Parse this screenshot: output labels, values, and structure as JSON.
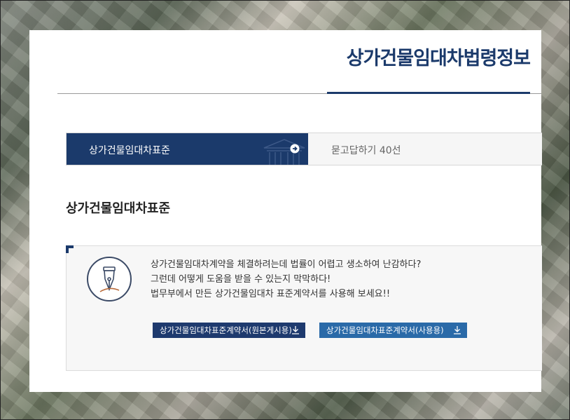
{
  "page": {
    "title": "상가건물임대차법령정보"
  },
  "tabs": [
    {
      "label": "상가건물임대차표준",
      "active": true
    },
    {
      "label": "묻고답하기 40선",
      "active": false
    }
  ],
  "section": {
    "title": "상가건물임대차표준",
    "description_lines": [
      "상가건물임대차계약을 체결하려는데 법률이 어렵고 생소하여 난감하다?",
      "그런데 어떻게 도움을 받을 수 있는지 막막하다!",
      "법무부에서 만든 상가건물임대차 표준계약서를 사용해 보세요!!"
    ],
    "buttons": [
      {
        "label": "상가건물임대차표준계약서(원본게시용)",
        "icon": "download-icon"
      },
      {
        "label": "상가건물임대차표준계약서(사용용)",
        "icon": "download-icon"
      }
    ]
  },
  "colors": {
    "brand_navy": "#1b3a6b",
    "button_blue": "#2a6aa8"
  }
}
